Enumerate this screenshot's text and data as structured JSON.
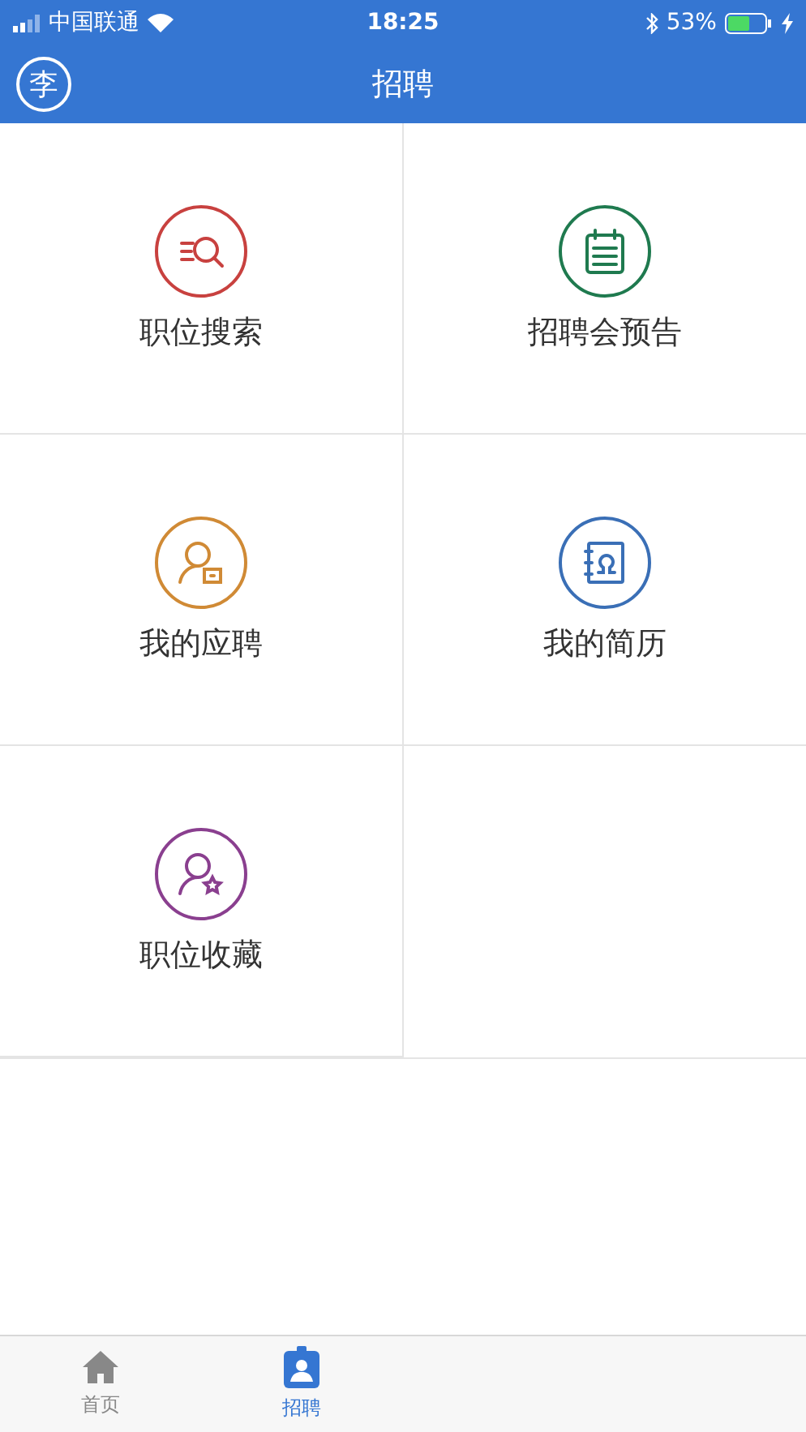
{
  "status_bar": {
    "carrier": "中国联通",
    "time": "18:25",
    "battery": "53%"
  },
  "nav_bar": {
    "avatar": "李",
    "title": "招聘"
  },
  "tiles": [
    {
      "label": "职位搜索",
      "kind": "search",
      "color": "#c8413f"
    },
    {
      "label": "招聘会预告",
      "kind": "calendar",
      "color": "#1f7a4f"
    },
    {
      "label": "我的应聘",
      "kind": "applicant",
      "color": "#d08a35"
    },
    {
      "label": "我的简历",
      "kind": "resume",
      "color": "#3a6fb6"
    },
    {
      "label": "职位收藏",
      "kind": "favorite",
      "color": "#8a3f8f"
    }
  ],
  "tab_bar": [
    {
      "label": "首页",
      "kind": "home",
      "selected": false
    },
    {
      "label": "招聘",
      "kind": "badge",
      "selected": true
    }
  ]
}
